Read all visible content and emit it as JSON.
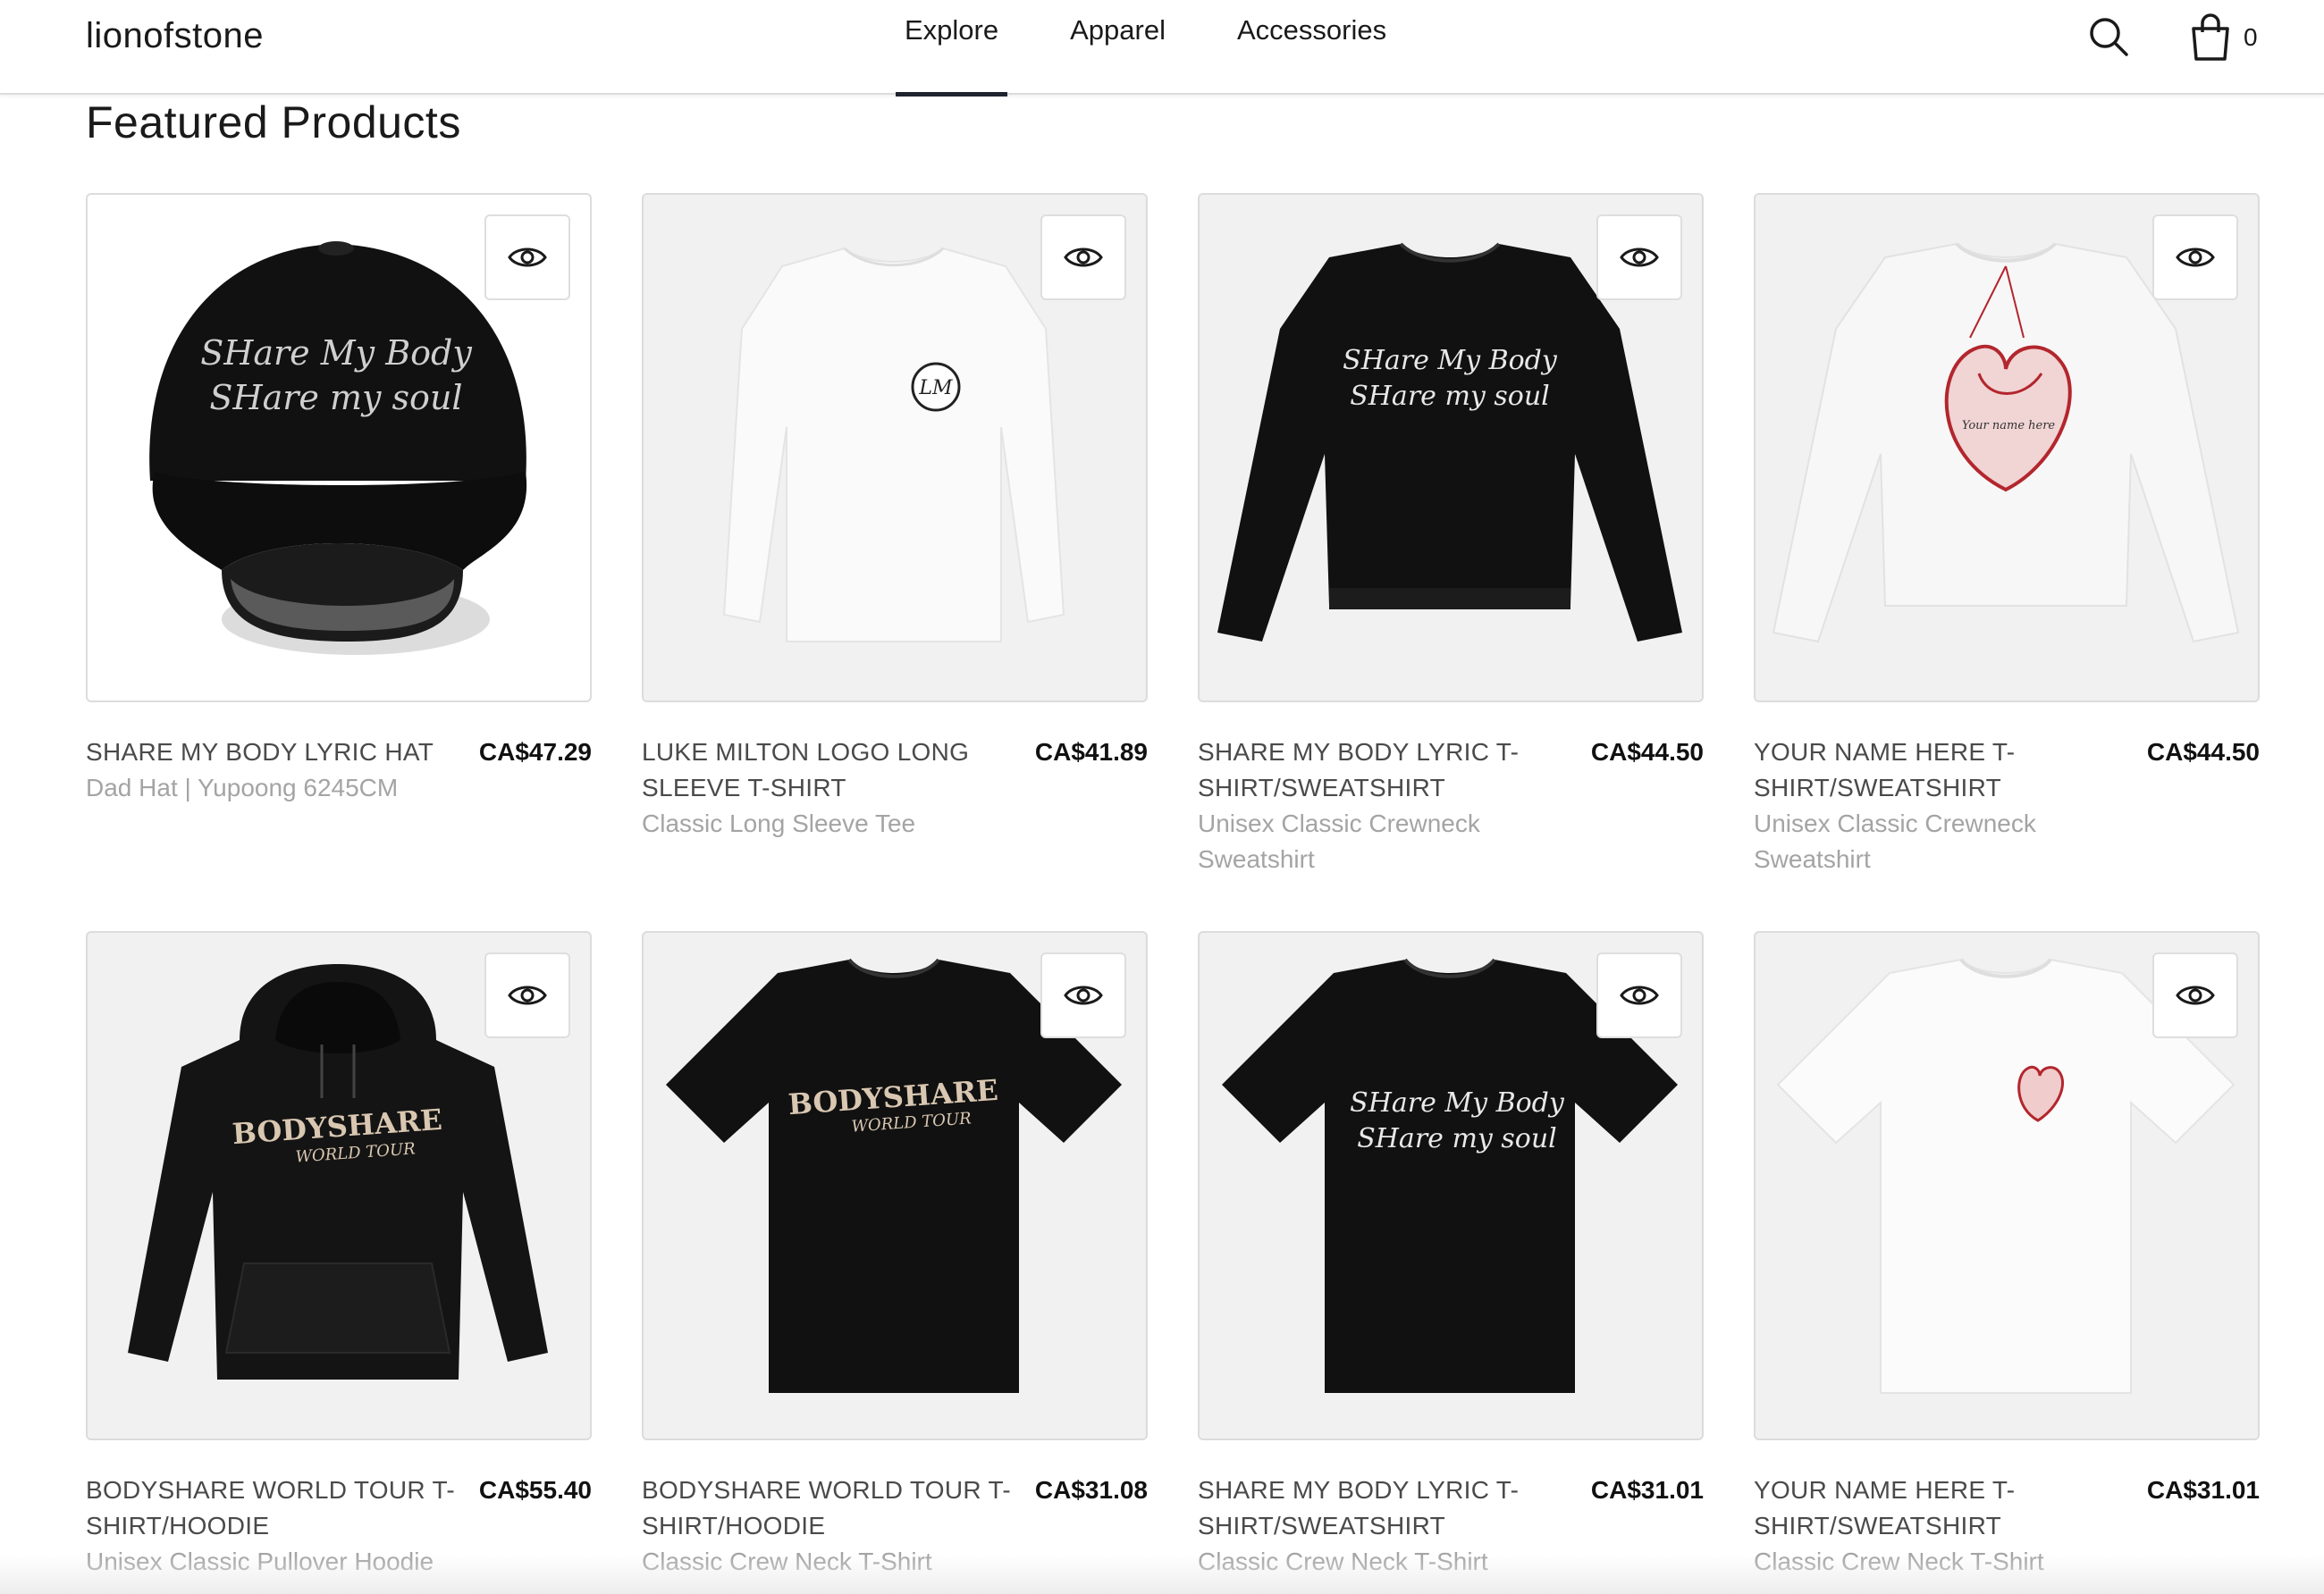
{
  "header": {
    "logo": "lionofstone",
    "nav": [
      {
        "label": "Explore",
        "active": true
      },
      {
        "label": "Apparel",
        "active": false
      },
      {
        "label": "Accessories",
        "active": false
      }
    ],
    "search_icon": "search-icon",
    "cart_icon": "shopping-bag-icon",
    "cart_count": "0"
  },
  "section": {
    "title": "Featured Products"
  },
  "products": [
    {
      "name": "SHARE MY BODY LYRIC HAT",
      "price": "CA$47.29",
      "variant": "Dad Hat | Yupoong 6245CM",
      "image": "black dad hat with Share My Body lyric print"
    },
    {
      "name": "LUKE MILTON LOGO LONG SLEEVE T-SHIRT",
      "price": "CA$41.89",
      "variant": "Classic Long Sleeve Tee",
      "image": "white long sleeve tee with LM logo"
    },
    {
      "name": "SHARE MY BODY LYRIC T-SHIRT/SWEATSHIRT",
      "price": "CA$44.50",
      "variant": "Unisex Classic Crewneck Sweatshirt",
      "image": "black crewneck sweatshirt with lyric print"
    },
    {
      "name": "YOUR NAME HERE T-SHIRT/SWEATSHIRT",
      "price": "CA$44.50",
      "variant": "Unisex Classic Crewneck Sweatshirt",
      "image": "white crewneck sweatshirt with red heart print"
    },
    {
      "name": "BODYSHARE WORLD TOUR T-SHIRT/HOODIE",
      "price": "CA$55.40",
      "variant": "Unisex Classic Pullover Hoodie",
      "image": "black pullover hoodie with Bodyshare World Tour print"
    },
    {
      "name": "BODYSHARE WORLD TOUR T-SHIRT/HOODIE",
      "price": "CA$31.08",
      "variant": "Classic Crew Neck T-Shirt",
      "image": "black t-shirt with Bodyshare World Tour print"
    },
    {
      "name": "SHARE MY BODY LYRIC T-SHIRT/SWEATSHIRT",
      "price": "CA$31.01",
      "variant": "Classic Crew Neck T-Shirt",
      "image": "black t-shirt with lyric print"
    },
    {
      "name": "YOUR NAME HERE T-SHIRT/SWEATSHIRT",
      "price": "CA$31.01",
      "variant": "Classic Crew Neck T-Shirt",
      "image": "white t-shirt with small red heart print"
    }
  ],
  "print_text": {
    "lyric_line1": "SHare My Body",
    "lyric_line2": "SHare my soul",
    "lm_logo": "LM",
    "bodyshare": "BODYSHARE",
    "world_tour": "WORLD TOUR",
    "heart_caption": "Your name here"
  },
  "quick_view_icon": "eye-icon",
  "colors": {
    "accent": "#1f2330",
    "muted_text": "#a4a4a4",
    "border": "#dcdcdc",
    "heart_red": "#b3262d"
  }
}
